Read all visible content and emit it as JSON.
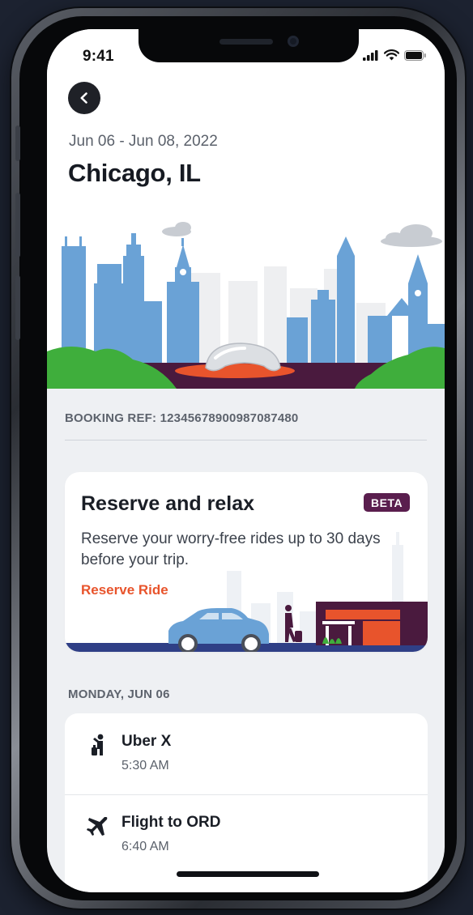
{
  "status": {
    "time": "9:41"
  },
  "trip": {
    "dates": "Jun 06 - Jun 08, 2022",
    "city": "Chicago, IL",
    "booking_ref": "BOOKING REF: 12345678900987087480"
  },
  "promo_card": {
    "title": "Reserve and relax",
    "badge": "BETA",
    "description": "Reserve your worry-free rides up to 30 days before your trip.",
    "link": "Reserve Ride"
  },
  "itinerary": {
    "day_label": "MONDAY, JUN 06",
    "items": [
      {
        "title": "Uber X",
        "time": "5:30 AM",
        "icon": "rider-icon"
      },
      {
        "title": "Flight to ORD",
        "time": "6:40 AM",
        "icon": "plane-icon"
      }
    ]
  },
  "colors": {
    "accent_orange": "#e8542c",
    "badge_purple": "#5a1e4e",
    "skyline_blue": "#6aa2d6",
    "park_green": "#3fae3c"
  }
}
